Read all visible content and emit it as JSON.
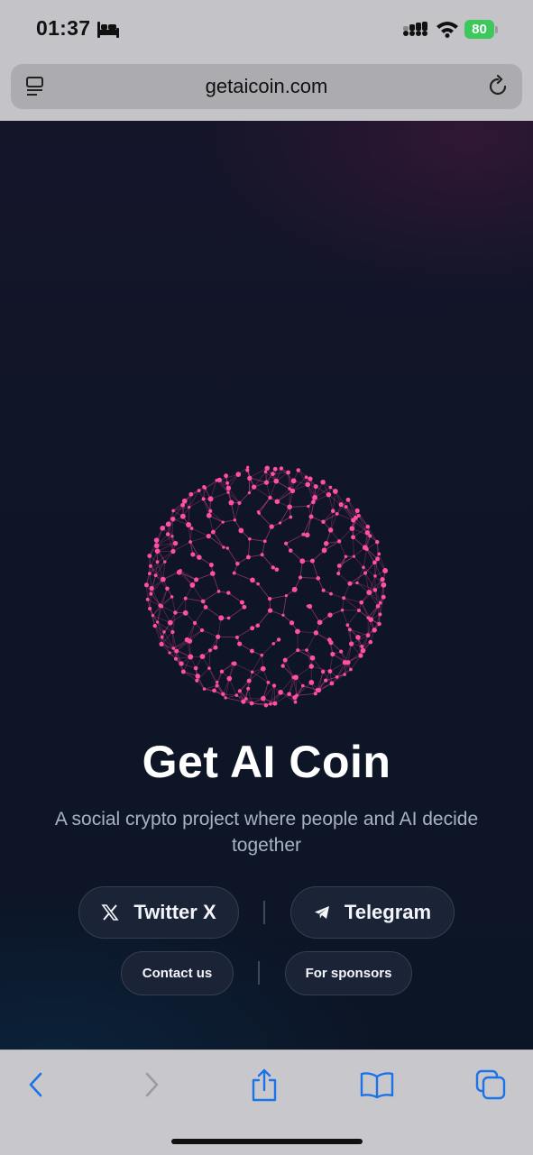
{
  "status_bar": {
    "time": "01:37",
    "battery_level": "80",
    "sleep_icon": "bed-icon",
    "signal_icon": "cellular-signal-icon",
    "wifi_icon": "wifi-icon",
    "battery_color": "#3cc85a"
  },
  "browser": {
    "url": "getaicoin.com",
    "reader_icon": "reader-mode-icon",
    "reload_icon": "reload-icon"
  },
  "hero": {
    "globe_icon": "network-globe-graphic",
    "globe_color": "#ff4fa6",
    "title": "Get AI Coin",
    "subtitle": "A social crypto project where people and AI decide together"
  },
  "links": {
    "twitter_label": "Twitter X",
    "telegram_label": "Telegram",
    "contact_label": "Contact us",
    "sponsors_label": "For sponsors"
  },
  "toolbar": {
    "icons": [
      "back-icon",
      "forward-icon",
      "share-icon",
      "bookmarks-icon",
      "tabs-icon"
    ],
    "accent_color": "#1a73e8"
  }
}
